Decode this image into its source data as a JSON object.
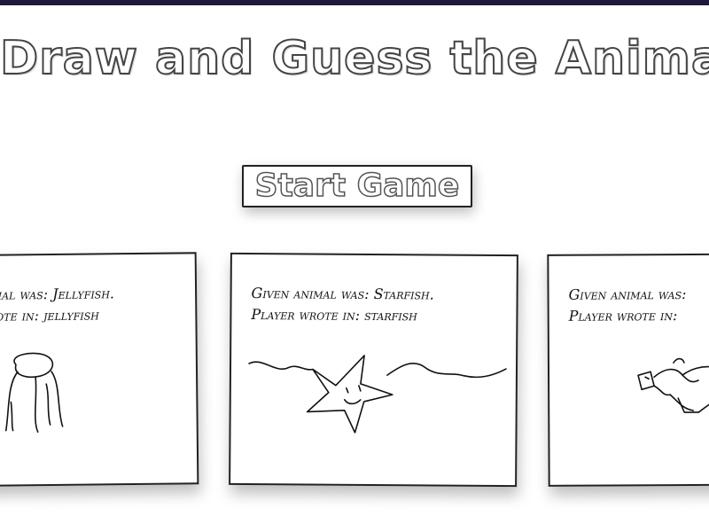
{
  "title": "Draw and Guess the Animal",
  "start_button_label": "Start Game",
  "cards": [
    {
      "given_line": "Given animal was: Jellyfish.",
      "wrote_line": "Player wrote in: jellyfish",
      "drawing": "jellyfish-drawing"
    },
    {
      "given_line": "Given animal was: Starfish.",
      "wrote_line": "Player wrote in: starfish",
      "drawing": "starfish-drawing"
    },
    {
      "given_line": "Given animal was:",
      "wrote_line": "Player wrote in:",
      "drawing": "animal-drawing"
    }
  ]
}
